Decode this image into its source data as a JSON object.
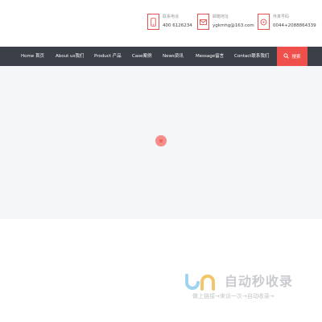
{
  "contacts": [
    {
      "label": "联系电话",
      "value": "400 6126234",
      "icon": "phone-icon"
    },
    {
      "label": "邮箱地址",
      "value": "ygkmhg@163.com",
      "icon": "mail-icon"
    },
    {
      "label": "传真号码",
      "value": "0044+2088864339",
      "icon": "fax-icon"
    }
  ],
  "nav": {
    "items": [
      "Home 首页",
      "About us我们",
      "Product 产品",
      "Case案例",
      "News资讯",
      "Message留言",
      "Contact联系我们"
    ],
    "search_label": "搜索"
  },
  "colors": {
    "accent": "#f0504b",
    "nav_bg": "#3b3f47",
    "banner_bg": "#f5f6f8"
  },
  "watermark": {
    "title": "自动秒收录",
    "subtitle": "做上链接→来访一次→自动收录→"
  }
}
